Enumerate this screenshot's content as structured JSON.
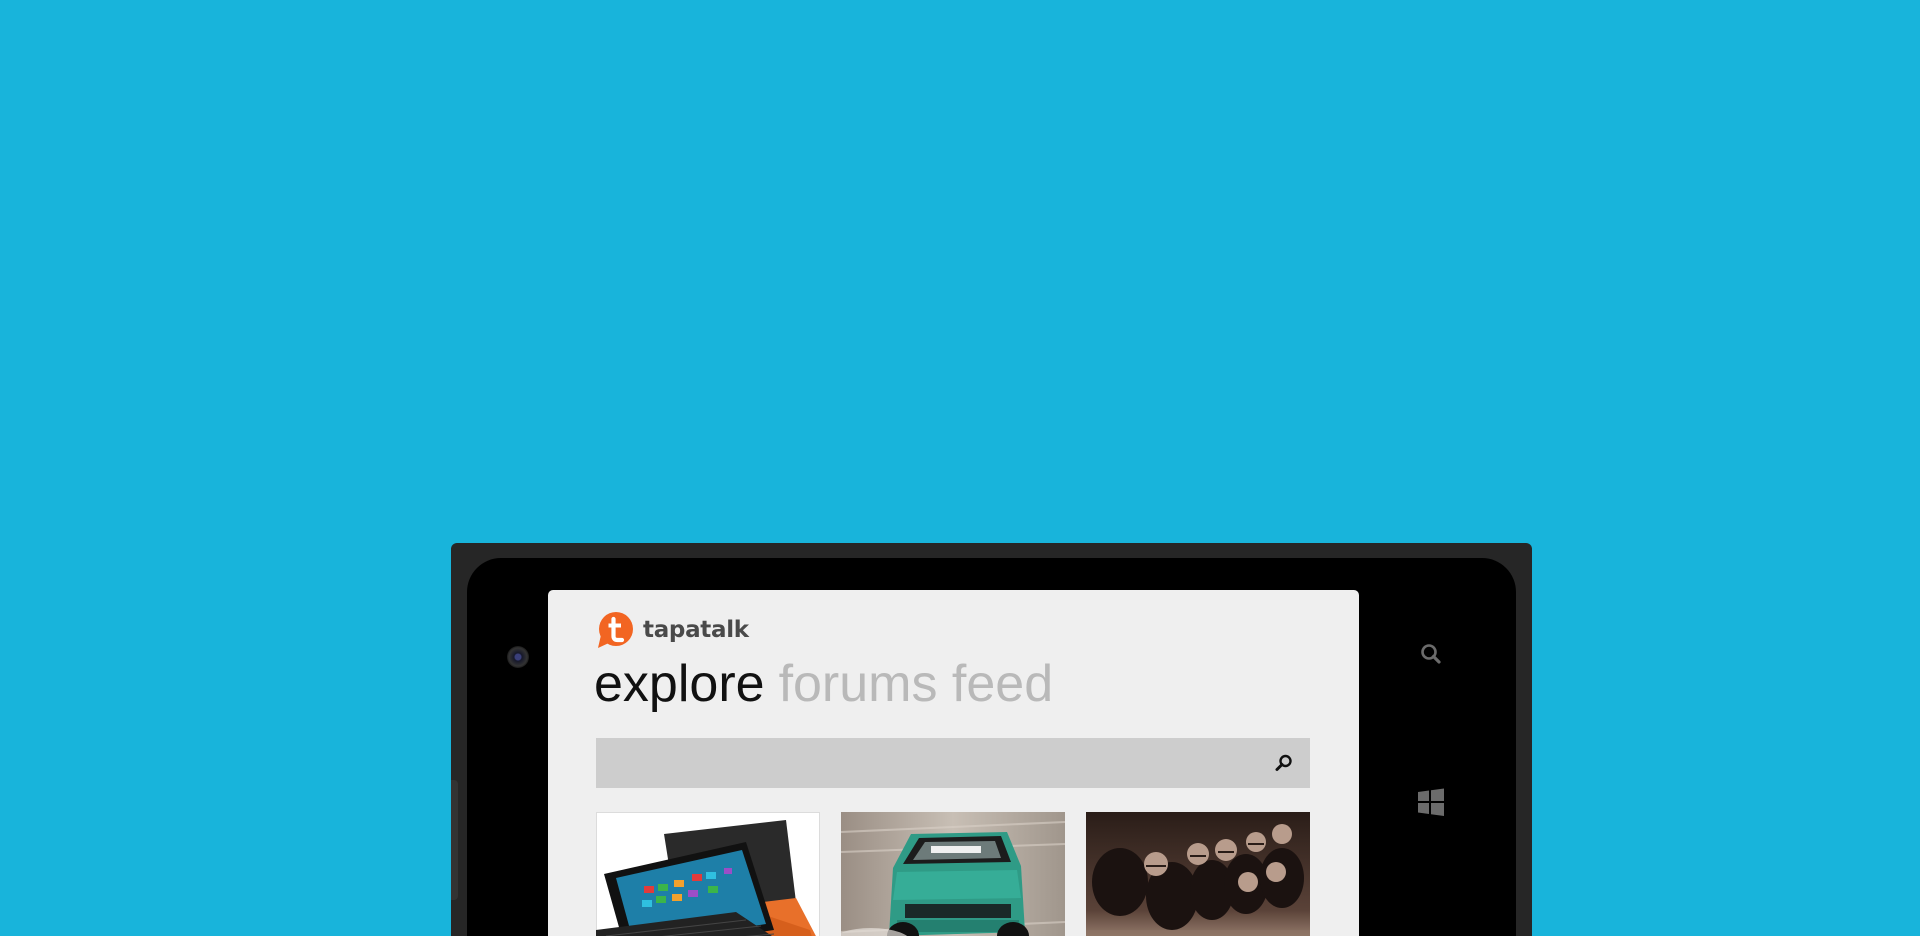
{
  "app": {
    "name": "tapatalk",
    "brand_color": "#f26522"
  },
  "pivot": {
    "tabs": [
      {
        "label": "explore",
        "active": true
      },
      {
        "label": "forums feed",
        "active": false
      }
    ]
  },
  "search": {
    "placeholder": "",
    "value": "",
    "icon": "search-icon"
  },
  "tiles": [
    {
      "subject": "laptop",
      "icon": "laptop-image"
    },
    {
      "subject": "drift car",
      "icon": "car-image"
    },
    {
      "subject": "football players",
      "icon": "football-image"
    }
  ],
  "device": {
    "hardware_buttons": [
      "search-icon",
      "windows-icon"
    ],
    "background_color": "#18b4db"
  }
}
